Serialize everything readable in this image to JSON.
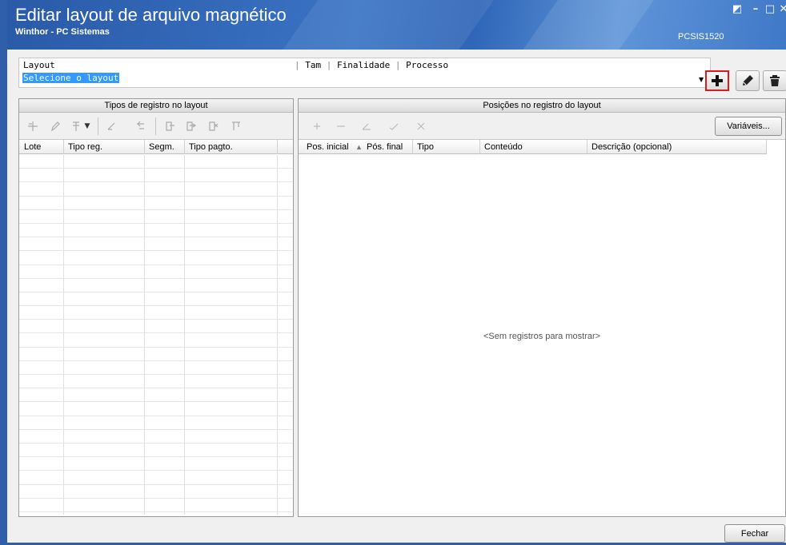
{
  "window": {
    "title": "Editar layout de arquivo magnético",
    "subtitle": "Winthor - PC Sistemas",
    "code": "PCSIS1520",
    "controls": {
      "restore": "◩",
      "minimize": "–",
      "maximize": "□",
      "close": "✕"
    }
  },
  "layout": {
    "col1": "Layout",
    "col2": "Tam",
    "col3": "Finalidade",
    "col4": "Processo",
    "value": "Selecione o layout"
  },
  "actions": {
    "add_icon": "plus-icon",
    "edit_icon": "pencil-icon",
    "delete_icon": "trash-icon",
    "highlight_color": "#e0191c"
  },
  "left_panel": {
    "title": "Tipos de registro no layout",
    "columns": [
      "Lote",
      "Tipo reg.",
      "Segm.",
      "Tipo pagto."
    ]
  },
  "right_panel": {
    "title": "Posições no registro do layout",
    "variables_button": "Variáveis...",
    "columns": [
      "Pos. inicial",
      "Pós. final",
      "Tipo",
      "Conteúdo",
      "Descrição (opcional)"
    ],
    "sort_indicator": "▲",
    "empty_message": "<Sem registros para mostrar>"
  },
  "footer": {
    "close_button": "Fechar"
  },
  "colors": {
    "titlebar": "#2f66b8",
    "selection": "#3399ff"
  }
}
